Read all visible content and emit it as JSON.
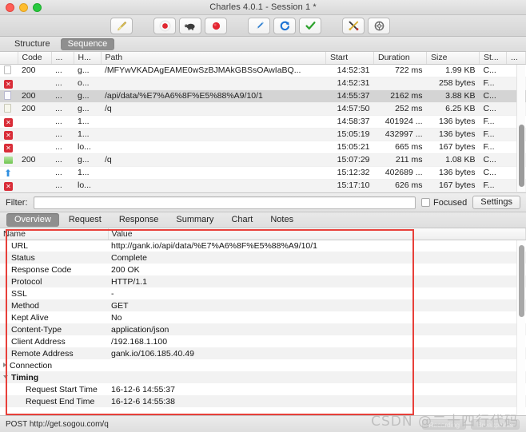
{
  "window": {
    "title": "Charles 4.0.1 - Session 1 *",
    "controls": [
      "close",
      "minimize",
      "zoom"
    ]
  },
  "toolbar": {
    "buttons": [
      {
        "name": "clear-session-button",
        "icon": "broom-icon",
        "group": 1
      },
      {
        "name": "start-stop-recording-button",
        "icon": "record-red-dot-icon",
        "group": 2
      },
      {
        "name": "throttle-button",
        "icon": "turtle-icon",
        "group": 2
      },
      {
        "name": "breakpoints-button",
        "icon": "red-circle-icon",
        "group": 2
      },
      {
        "name": "compose-button",
        "icon": "blue-pen-icon",
        "group": 3
      },
      {
        "name": "repeat-button",
        "icon": "blue-refresh-icon",
        "group": 3
      },
      {
        "name": "validate-button",
        "icon": "green-check-icon",
        "group": 3
      },
      {
        "name": "tools-button",
        "icon": "tools-cross-icon",
        "group": 4
      },
      {
        "name": "settings-button",
        "icon": "gear-globe-icon",
        "group": 4
      }
    ]
  },
  "view_tabs": {
    "items": [
      {
        "label": "Structure",
        "active": false
      },
      {
        "label": "Sequence",
        "active": true
      }
    ]
  },
  "session_table": {
    "columns": [
      "",
      "Code",
      "...",
      "H...",
      "Path",
      "Start",
      "Duration",
      "Size",
      "St...",
      "..."
    ],
    "rows": [
      {
        "icon": "document-icon",
        "code": "200",
        "dots": "...",
        "host": "g...",
        "path": "/MFYwVKADAgEAME0wSzBJMAkGBSsOAwIaBQ...",
        "start": "14:52:31",
        "duration": "722 ms",
        "size": "1.99 KB",
        "status": "C...",
        "selected": false
      },
      {
        "icon": "error-x-icon",
        "code": "",
        "dots": "...",
        "host": "o...",
        "path": "",
        "start": "14:52:31",
        "duration": "",
        "size": "258 bytes",
        "status": "F...",
        "selected": false
      },
      {
        "icon": "bar-icon",
        "code": "200",
        "dots": "...",
        "host": "g...",
        "path": "/api/data/%E7%A6%8F%E5%88%A9/10/1",
        "start": "14:55:37",
        "duration": "2162 ms",
        "size": "3.88 KB",
        "status": "C...",
        "selected": true
      },
      {
        "icon": "page-icon",
        "code": "200",
        "dots": "...",
        "host": "g...",
        "path": "/q",
        "start": "14:57:50",
        "duration": "252 ms",
        "size": "6.25 KB",
        "status": "C...",
        "selected": false
      },
      {
        "icon": "error-x-icon",
        "code": "",
        "dots": "...",
        "host": "1...",
        "path": "",
        "start": "14:58:37",
        "duration": "401924 ...",
        "size": "136 bytes",
        "status": "F...",
        "selected": false
      },
      {
        "icon": "error-x-icon",
        "code": "",
        "dots": "...",
        "host": "1...",
        "path": "",
        "start": "15:05:19",
        "duration": "432997 ...",
        "size": "136 bytes",
        "status": "F...",
        "selected": false
      },
      {
        "icon": "error-x-icon",
        "code": "",
        "dots": "...",
        "host": "lo...",
        "path": "",
        "start": "15:05:21",
        "duration": "665 ms",
        "size": "167 bytes",
        "status": "F...",
        "selected": false
      },
      {
        "icon": "green-chart-icon",
        "code": "200",
        "dots": "...",
        "host": "g...",
        "path": "/q",
        "start": "15:07:29",
        "duration": "211 ms",
        "size": "1.08 KB",
        "status": "C...",
        "selected": false
      },
      {
        "icon": "blue-up-arrow-icon",
        "code": "",
        "dots": "...",
        "host": "1...",
        "path": "",
        "start": "15:12:32",
        "duration": "402689 ...",
        "size": "136 bytes",
        "status": "C...",
        "selected": false
      },
      {
        "icon": "error-x-icon",
        "code": "",
        "dots": "...",
        "host": "lo...",
        "path": "",
        "start": "15:17:10",
        "duration": "626 ms",
        "size": "167 bytes",
        "status": "F...",
        "selected": false
      }
    ]
  },
  "filter_bar": {
    "label": "Filter:",
    "value": "",
    "placeholder": "",
    "focused_label": "Focused",
    "focused_checked": false,
    "settings_label": "Settings"
  },
  "detail_tabs": {
    "items": [
      {
        "label": "Overview",
        "active": true
      },
      {
        "label": "Request",
        "active": false
      },
      {
        "label": "Response",
        "active": false
      },
      {
        "label": "Summary",
        "active": false
      },
      {
        "label": "Chart",
        "active": false
      },
      {
        "label": "Notes",
        "active": false
      }
    ]
  },
  "overview": {
    "columns": [
      "Name",
      "Value"
    ],
    "rows": [
      {
        "name": "URL",
        "value": "http://gank.io/api/data/%E7%A6%8F%E5%88%A9/10/1",
        "level": 1,
        "disclosure": "",
        "bold": false
      },
      {
        "name": "Status",
        "value": "Complete",
        "level": 1,
        "disclosure": "",
        "bold": false
      },
      {
        "name": "Response Code",
        "value": "200 OK",
        "level": 1,
        "disclosure": "",
        "bold": false
      },
      {
        "name": "Protocol",
        "value": "HTTP/1.1",
        "level": 1,
        "disclosure": "",
        "bold": false
      },
      {
        "name": "SSL",
        "value": "-",
        "level": 1,
        "disclosure": "",
        "bold": false
      },
      {
        "name": "Method",
        "value": "GET",
        "level": 1,
        "disclosure": "",
        "bold": false
      },
      {
        "name": "Kept Alive",
        "value": "No",
        "level": 1,
        "disclosure": "",
        "bold": false
      },
      {
        "name": "Content-Type",
        "value": "application/json",
        "level": 1,
        "disclosure": "",
        "bold": false
      },
      {
        "name": "Client Address",
        "value": "/192.168.1.100",
        "level": 1,
        "disclosure": "",
        "bold": false
      },
      {
        "name": "Remote Address",
        "value": "gank.io/106.185.40.49",
        "level": 1,
        "disclosure": "",
        "bold": false
      },
      {
        "name": "Connection",
        "value": "",
        "level": 0,
        "disclosure": "collapsed",
        "bold": false
      },
      {
        "name": "Timing",
        "value": "",
        "level": 0,
        "disclosure": "expanded",
        "bold": true
      },
      {
        "name": "Request Start Time",
        "value": "16-12-6 14:55:37",
        "level": 2,
        "disclosure": "",
        "bold": false
      },
      {
        "name": "Request End Time",
        "value": "16-12-6 14:55:38",
        "level": 2,
        "disclosure": "",
        "bold": false
      }
    ]
  },
  "status_bar": {
    "text": "POST http://get.sogou.com/q",
    "ghost_buttons": [
      "Recording",
      "Breakpoints"
    ]
  },
  "watermark": {
    "text": "CSDN @二十四行代码"
  },
  "colors": {
    "accent_selection": "#d4d4d4",
    "annotation_red": "#e8403a",
    "error_red": "#d92d38",
    "tab_active": "#8f8f8f"
  }
}
